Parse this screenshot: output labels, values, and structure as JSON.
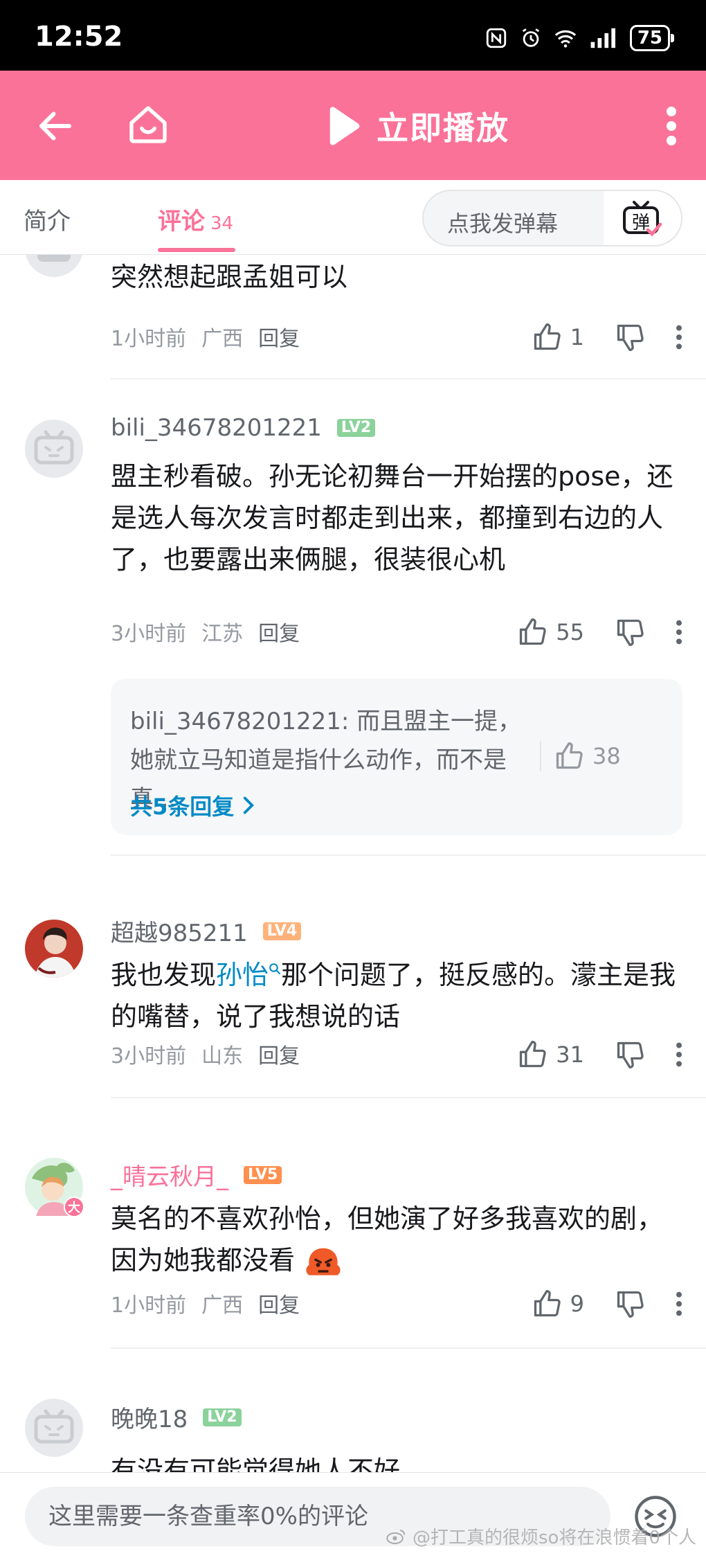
{
  "status_bar": {
    "time": "12:52",
    "battery": "75"
  },
  "nav": {
    "play_label": "立即播放"
  },
  "tabs": {
    "intro": "简介",
    "comments": "评论",
    "comment_count": "34",
    "danmaku_placeholder": "点我发弹幕",
    "danmaku_button": "弹"
  },
  "comments": [
    {
      "text": "突然想起跟孟姐可以",
      "time": "1小时前",
      "region": "广西",
      "reply": "回复",
      "likes": "1"
    },
    {
      "user": "bili_34678201221",
      "level": "LV2",
      "text": "盟主秒看破。孙无论初舞台一开始摆的pose，还是选人每次发言时都走到出来，都撞到右边的人了，也要露出来俩腿，很装很心机",
      "time": "3小时前",
      "region": "江苏",
      "reply": "回复",
      "likes": "55",
      "sub": {
        "text": "bili_34678201221: 而且盟主一提，她就立马知道是指什么动作，而不是真...",
        "likes": "38",
        "more": "共5条回复"
      }
    },
    {
      "user": "超越985211",
      "level": "LV4",
      "text_before": "我也发现",
      "text_highlight": "孙怡",
      "text_after": "那个问题了，挺反感的。濛主是我的嘴替，说了我想说的话",
      "time": "3小时前",
      "region": "山东",
      "reply": "回复",
      "likes": "31"
    },
    {
      "user": "_晴云秋月_",
      "level": "LV5",
      "text": "莫名的不喜欢孙怡，但她演了好多我喜欢的剧，因为她我都没看",
      "time": "1小时前",
      "region": "广西",
      "reply": "回复",
      "likes": "9",
      "badge": "大"
    },
    {
      "user": "晚晚18",
      "level": "LV2",
      "text": "有没有可能觉得她人不好"
    }
  ],
  "input": {
    "placeholder": "这里需要一条查重率0%的评论"
  },
  "watermark": "@打工真的很烦so将在浪惯着0个人",
  "colors": {
    "brand_pink": "#fb7299",
    "link_blue": "#008ac5"
  }
}
